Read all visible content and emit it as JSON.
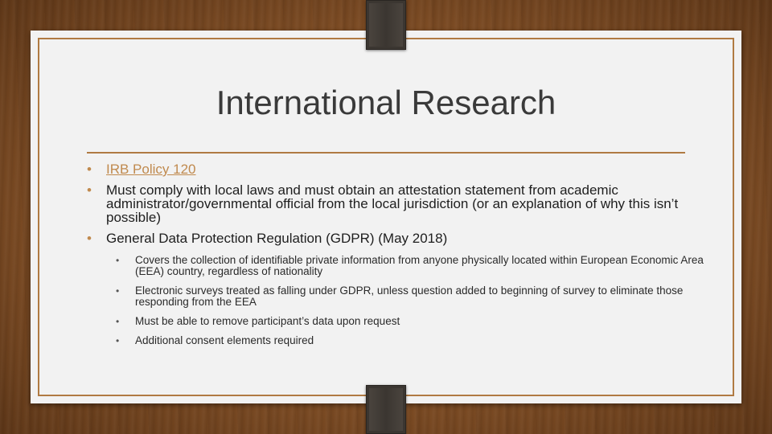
{
  "slide": {
    "title": "International Research",
    "bullets": [
      {
        "text": "IRB Policy 120",
        "link": true
      },
      {
        "text": "Must comply with local laws and must obtain an attestation statement from academic administrator/governmental official from the local jurisdiction (or an explanation of why this isn’t possible)",
        "link": false
      },
      {
        "text": "General Data Protection Regulation (GDPR) (May 2018)",
        "link": false
      }
    ],
    "sub_bullets": [
      "Covers the collection of identifiable private information from anyone physically located within European Economic Area (EEA) country, regardless of nationality",
      "Electronic surveys treated as falling under GDPR, unless question added to beginning of survey to eliminate those responding from the EEA",
      "Must be able to remove participant’s data upon request",
      "Additional consent elements required"
    ],
    "bullet_glyph": "•"
  },
  "colors": {
    "accent": "#c08a4e",
    "frame": "#b07a42",
    "card": "#f2f2f2",
    "clip": "#3b3631"
  }
}
